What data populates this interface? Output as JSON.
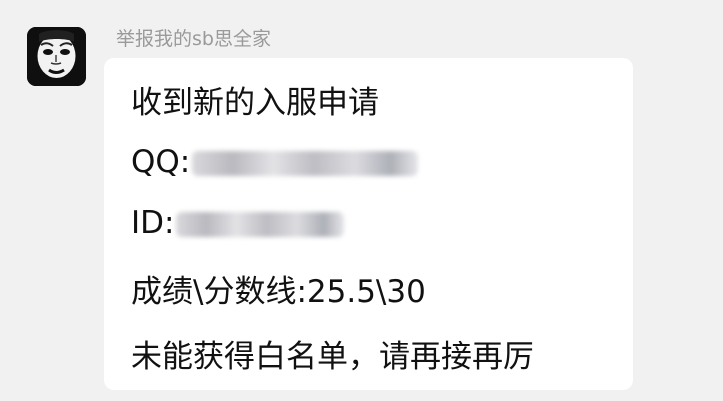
{
  "message": {
    "sender_name": "举报我的sb思全家",
    "avatar": "panda-meme-face-avatar",
    "lines": {
      "title": "收到新的入服申请",
      "qq_label": "QQ:",
      "id_label": "ID:",
      "score": "成绩\\分数线:25.5\\30",
      "result": "未能获得白名单，请再接再厉"
    }
  }
}
